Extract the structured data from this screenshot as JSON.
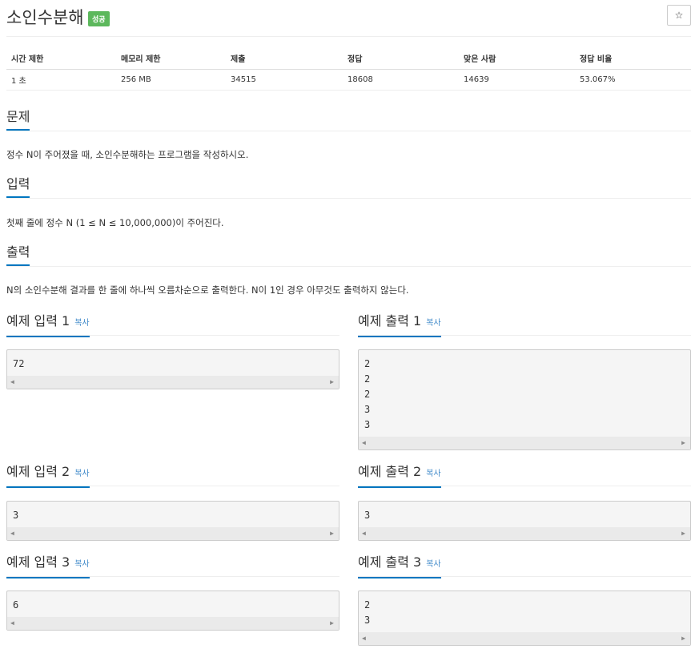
{
  "header": {
    "title": "소인수분해",
    "badge": "성공",
    "star_icon": "☆"
  },
  "info_table": {
    "headers": [
      "시간 제한",
      "메모리 제한",
      "제출",
      "정답",
      "맞은 사람",
      "정답 비율"
    ],
    "values": [
      "1 초",
      "256 MB",
      "34515",
      "18608",
      "14639",
      "53.067%"
    ]
  },
  "problem": {
    "heading": "문제",
    "text": "정수 N이 주어졌을 때, 소인수분해하는 프로그램을 작성하시오."
  },
  "input": {
    "heading": "입력",
    "text": "첫째 줄에 정수 N (1 ≤ N ≤ 10,000,000)이 주어진다."
  },
  "output": {
    "heading": "출력",
    "text": "N의 소인수분해 결과를 한 줄에 하나씩 오름차순으로 출력한다. N이 1인 경우 아무것도 출력하지 않는다."
  },
  "copy_label": "복사",
  "samples": [
    {
      "input_heading": "예제 입력 1",
      "input": [
        "72"
      ],
      "output_heading": "예제 출력 1",
      "output": [
        "2",
        "2",
        "2",
        "3",
        "3"
      ]
    },
    {
      "input_heading": "예제 입력 2",
      "input": [
        "3"
      ],
      "output_heading": "예제 출력 2",
      "output": [
        "3"
      ]
    },
    {
      "input_heading": "예제 입력 3",
      "input": [
        "6"
      ],
      "output_heading": "예제 출력 3",
      "output": [
        "2",
        "3"
      ]
    }
  ]
}
